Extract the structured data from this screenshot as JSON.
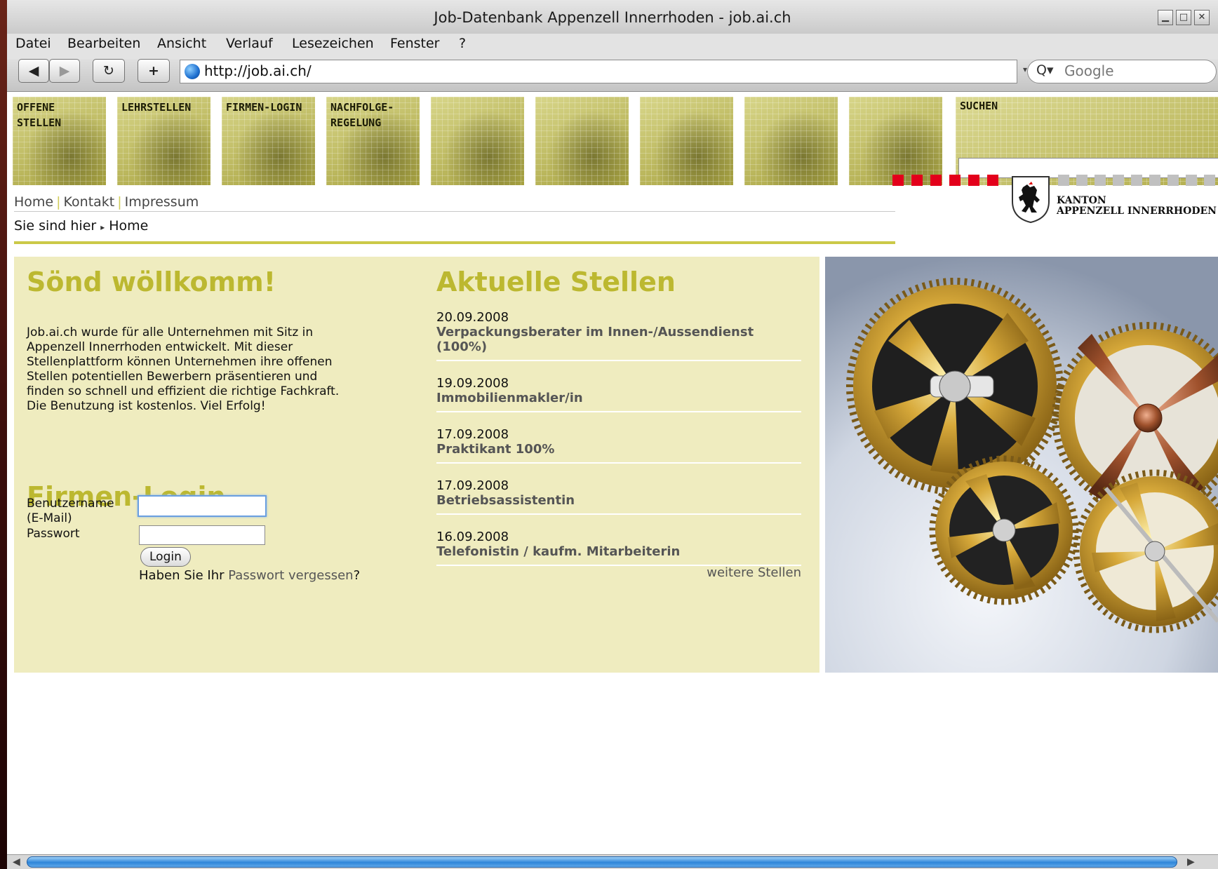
{
  "window": {
    "title": "Job-Datenbank Appenzell Innerrhoden - job.ai.ch",
    "controls": [
      "minimize-icon",
      "maximize-icon",
      "close-icon"
    ]
  },
  "menu": {
    "items": [
      "Datei",
      "Bearbeiten",
      "Ansicht",
      "Verlauf",
      "Lesezeichen",
      "Fenster",
      "?"
    ]
  },
  "toolbar": {
    "back_glyph": "◀",
    "forward_glyph": "▶",
    "reload_glyph": "↻",
    "add_glyph": "+",
    "url": "http://job.ai.ch/",
    "search_icon_glyph": "Q▾",
    "search_placeholder": "Google"
  },
  "nav": {
    "tiles": [
      {
        "label": "OFFENE\nSTELLEN"
      },
      {
        "label": "LEHRSTELLEN"
      },
      {
        "label": "FIRMEN-LOGIN"
      },
      {
        "label": "NACHFOLGE-\nREGELUNG"
      },
      {
        "label": ""
      },
      {
        "label": ""
      },
      {
        "label": ""
      },
      {
        "label": ""
      },
      {
        "label": ""
      }
    ],
    "search_label": "SUCHEN"
  },
  "links": [
    "Home",
    "Kontakt",
    "Impressum"
  ],
  "breadcrumb": {
    "prefix": "Sie sind hier",
    "arrow": "▸",
    "current": "Home"
  },
  "canton": {
    "line1": "KANTON",
    "line2": "APPENZELL INNERRHODEN"
  },
  "welcome": {
    "heading": "Sönd wöllkomm!",
    "lines": [
      "Job.ai.ch wurde für alle Unternehmen mit Sitz in",
      "Appenzell Innerrhoden entwickelt. Mit dieser",
      "Stellenplattform können Unternehmen ihre offenen",
      "Stellen potentiellen Bewerbern präsentieren und",
      "finden so schnell und effizient die richtige Fachkraft.",
      "Die Benutzung ist kostenlos. Viel Erfolg!"
    ]
  },
  "login": {
    "heading": "Firmen-Login",
    "user_label_1": "Benutzername",
    "user_label_2": "(E-Mail)",
    "password_label": "Passwort",
    "user_value": "",
    "password_value": "",
    "button": "Login",
    "forgot_prefix": "Haben Sie Ihr ",
    "forgot_link": "Passwort vergessen",
    "forgot_suffix": "?"
  },
  "jobs": {
    "heading": "Aktuelle Stellen",
    "items": [
      {
        "date": "20.09.2008",
        "title": "Verpackungsberater im Innen-/Aussendienst (100%)"
      },
      {
        "date": "19.09.2008",
        "title": "Immobilienmakler/in"
      },
      {
        "date": "17.09.2008",
        "title": "Praktikant 100%"
      },
      {
        "date": "17.09.2008",
        "title": "Betriebsassistentin"
      },
      {
        "date": "16.09.2008",
        "title": "Telefonistin / kaufm. Mitarbeiterin"
      }
    ],
    "more": "weitere Stellen"
  },
  "scrollbar": {
    "left_glyph": "◀",
    "right_glyph": "▶"
  },
  "colors": {
    "accent": "#bcb830",
    "panel": "#efecbf",
    "rule": "#cbc948",
    "canton_red": "#e3001b"
  }
}
